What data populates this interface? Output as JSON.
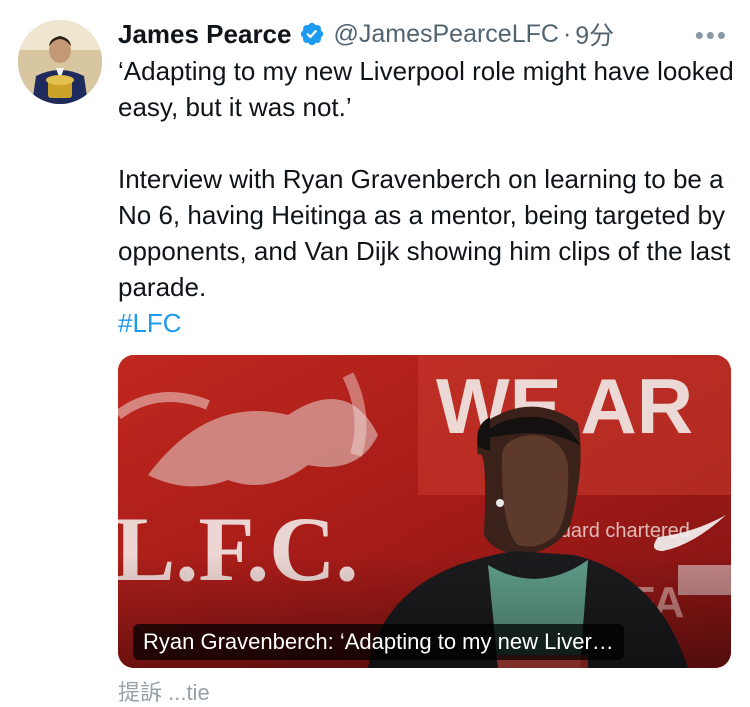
{
  "tweet": {
    "author_name": "James Pearce",
    "handle": "@JamesPearceLFC",
    "separator": "·",
    "time": "9分",
    "more_label": "•••",
    "text_line1": "‘Adapting to my new Liverpool role might have looked easy, but it was not.’",
    "text_line2": "Interview with Ryan Gravenberch on learning to be a No 6, having Heitinga as a mentor, being targeted by opponents, and Van Dijk showing him clips of the last parade.",
    "hashtag": "#LFC"
  },
  "card": {
    "caption": "Ryan Gravenberch: ‘Adapting to my new Liver…",
    "photo_signage": {
      "banner_top": "WE AR",
      "banner_left": "L.F.C.",
      "sponsor": "standard chartered",
      "banner_bottom": "THE FA"
    }
  },
  "footer_peek": "提訴  ...tie",
  "colors": {
    "link": "#1d9bf0",
    "secondary_text": "#536471",
    "verified": "#1d9bf0"
  }
}
